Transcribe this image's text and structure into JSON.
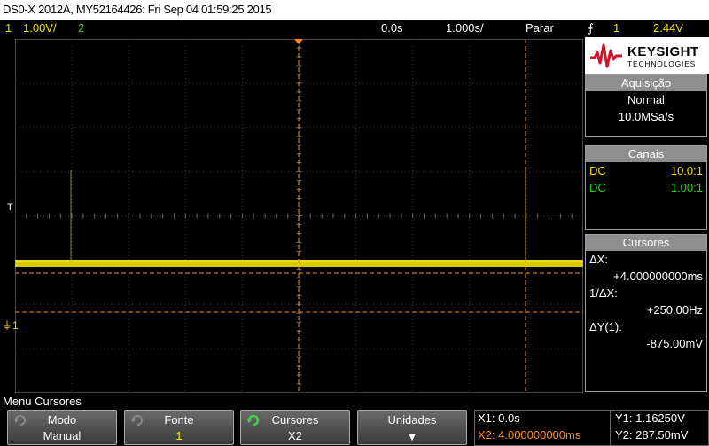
{
  "title": "DS0-X 2012A, MY52164426: Fri Sep 04 01:59:25 2015",
  "status": {
    "ch1_num": "1",
    "ch1_scale": "1.00V/",
    "ch2_num": "2",
    "time_pos": "0.0s",
    "time_scale": "1.000s/",
    "run_state": "Parar",
    "trigger_symbol": "⨍",
    "trigger_ch": "1",
    "trigger_level": "2.44V"
  },
  "markers": {
    "trigger_t": "T",
    "ch1_ground": "1"
  },
  "logo": {
    "brand": "KEYSIGHT",
    "sub": "TECHNOLOGIES"
  },
  "acquisition": {
    "header": "Aquisição",
    "mode": "Normal",
    "rate": "10.0MSa/s"
  },
  "channels": {
    "header": "Canais",
    "ch1_coupling": "DC",
    "ch1_probe": "10.0:1",
    "ch2_coupling": "DC",
    "ch2_probe": "1.00:1"
  },
  "cursors_panel": {
    "header": "Cursores",
    "dx_label": "ΔX:",
    "dx_value": "+4.000000000ms",
    "inv_dx_label": "1/ΔX:",
    "inv_dx_value": "+250.00Hz",
    "dy_label": "ΔY(1):",
    "dy_value": "-875.00mV"
  },
  "menu": {
    "title": "Menu Cursores",
    "softkeys": [
      {
        "label": "Modo",
        "value": "Manual"
      },
      {
        "label": "Fonte",
        "value": "1"
      },
      {
        "label": "Cursores",
        "value": "X2"
      },
      {
        "label": "Unidades",
        "value": "▼"
      }
    ]
  },
  "readout": {
    "x1": "X1: 0.0s",
    "x2": "X2: 4.000000000ms",
    "y1": "Y1: 1.16250V",
    "y2": "Y2: 287.50mV"
  },
  "colors": {
    "ch1": "#f2e200",
    "ch2": "#27d11f",
    "cursor": "#ff8c1a",
    "panel_header": "#8e8e8e"
  }
}
